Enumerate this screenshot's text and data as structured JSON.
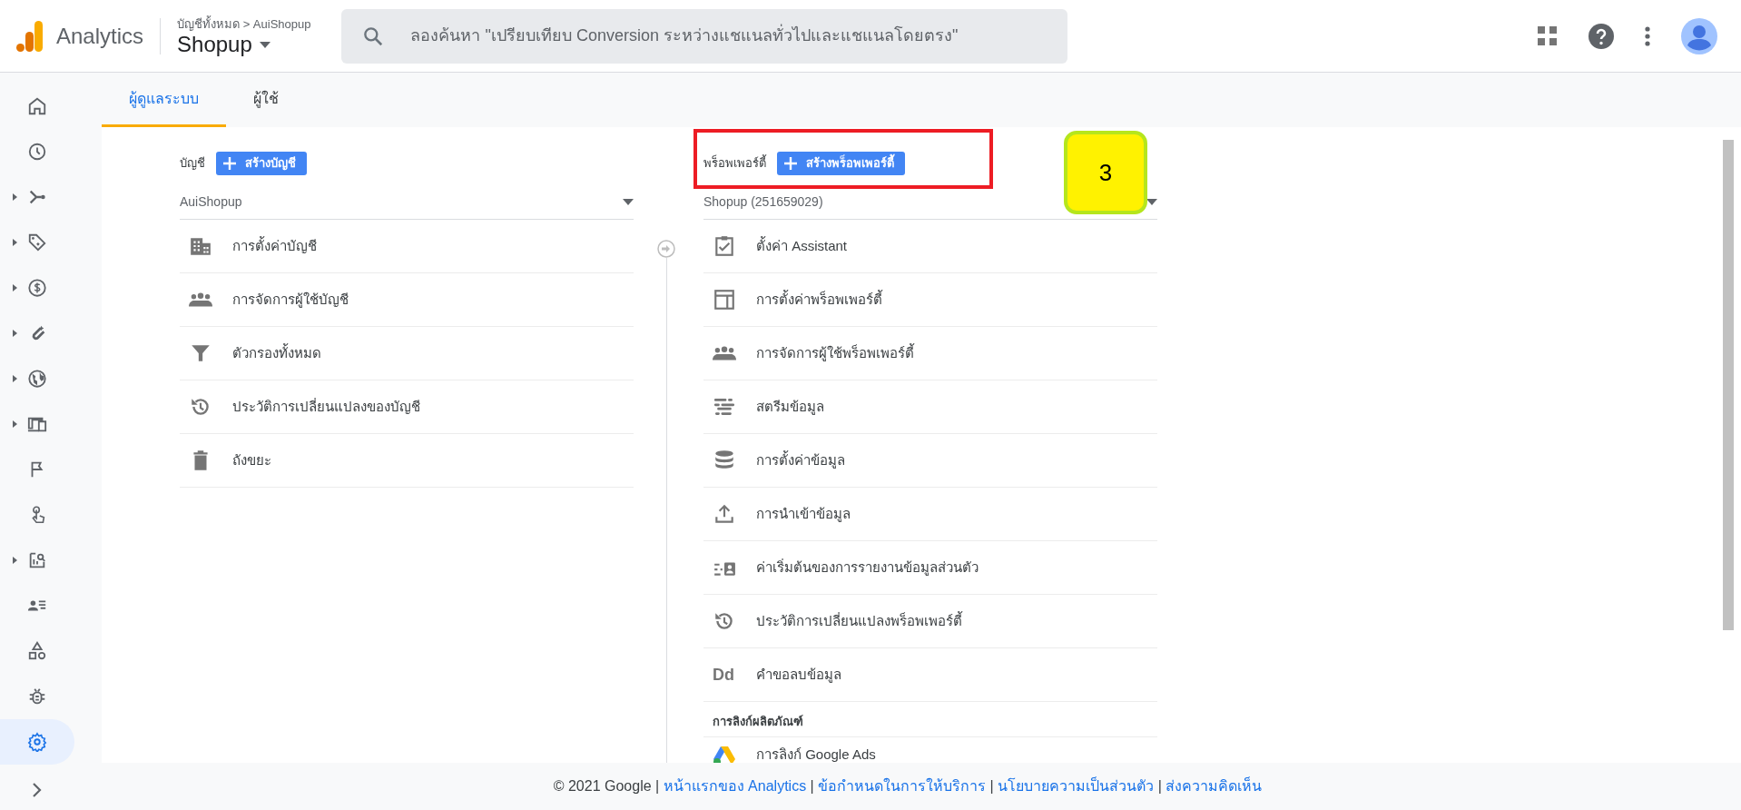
{
  "header": {
    "product": "Analytics",
    "breadcrumb": "บัญชีทั้งหมด > AuiShopup",
    "property": "Shopup",
    "search": {
      "placeholder": "ลองค้นหา \"เปรียบเทียบ Conversion ระหว่างแชแนลทั่วไปและแชแนลโดยตรง\""
    }
  },
  "nav": [
    {
      "expandable": false,
      "selected": false
    },
    {
      "expandable": false,
      "selected": false
    },
    {
      "expandable": true,
      "selected": false
    },
    {
      "expandable": true,
      "selected": false
    },
    {
      "expandable": true,
      "selected": false
    },
    {
      "expandable": true,
      "selected": false
    },
    {
      "expandable": true,
      "selected": false
    },
    {
      "expandable": true,
      "selected": false
    },
    {
      "expandable": false,
      "selected": false
    },
    {
      "expandable": false,
      "selected": false
    },
    {
      "expandable": true,
      "selected": false
    },
    {
      "expandable": false,
      "selected": false
    },
    {
      "expandable": false,
      "selected": false
    },
    {
      "expandable": false,
      "selected": false
    },
    {
      "expandable": false,
      "selected": true
    }
  ],
  "tabs": [
    {
      "label": "ผู้ดูแลระบบ",
      "selected": true
    },
    {
      "label": "ผู้ใช้",
      "selected": false
    }
  ],
  "account": {
    "label": "บัญชี",
    "create_button": "สร้างบัญชี",
    "selector": "AuiShopup",
    "items": [
      {
        "label": "การตั้งค่าบัญชี"
      },
      {
        "label": "การจัดการผู้ใช้บัญชี"
      },
      {
        "label": "ตัวกรองทั้งหมด"
      },
      {
        "label": "ประวัติการเปลี่ยนแปลงของบัญชี"
      },
      {
        "label": "ถังขยะ"
      }
    ]
  },
  "property": {
    "label": "พร็อพเพอร์ตี้",
    "create_button": "สร้างพร็อพเพอร์ตี้",
    "selector": "Shopup (251659029)",
    "items": [
      {
        "label": "ตั้งค่า Assistant"
      },
      {
        "label": "การตั้งค่าพร็อพเพอร์ตี้"
      },
      {
        "label": "การจัดการผู้ใช้พร็อพเพอร์ตี้"
      },
      {
        "label": "สตรีมข้อมูล"
      },
      {
        "label": "การตั้งค่าข้อมูล"
      },
      {
        "label": "การนำเข้าข้อมูล"
      },
      {
        "label": "ค่าเริ่มต้นของการรายงานข้อมูลส่วนตัว"
      },
      {
        "label": "ประวัติการเปลี่ยนแปลงพร็อพเพอร์ตี้"
      },
      {
        "label": "คำขอลบข้อมูล",
        "icon_text": "Dd"
      }
    ],
    "section": {
      "title": "การลิงก์ผลิตภัณฑ์",
      "items": [
        {
          "label": "การลิงก์ Google Ads"
        }
      ]
    }
  },
  "annotation": {
    "step": "3"
  },
  "footer": {
    "copyright": "© 2021 Google",
    "separator": "|",
    "links": [
      "หน้าแรกของ Analytics",
      "ข้อกำหนดในการให้บริการ",
      "นโยบายความเป็นส่วนตัว",
      "ส่งความคิดเห็น"
    ]
  }
}
